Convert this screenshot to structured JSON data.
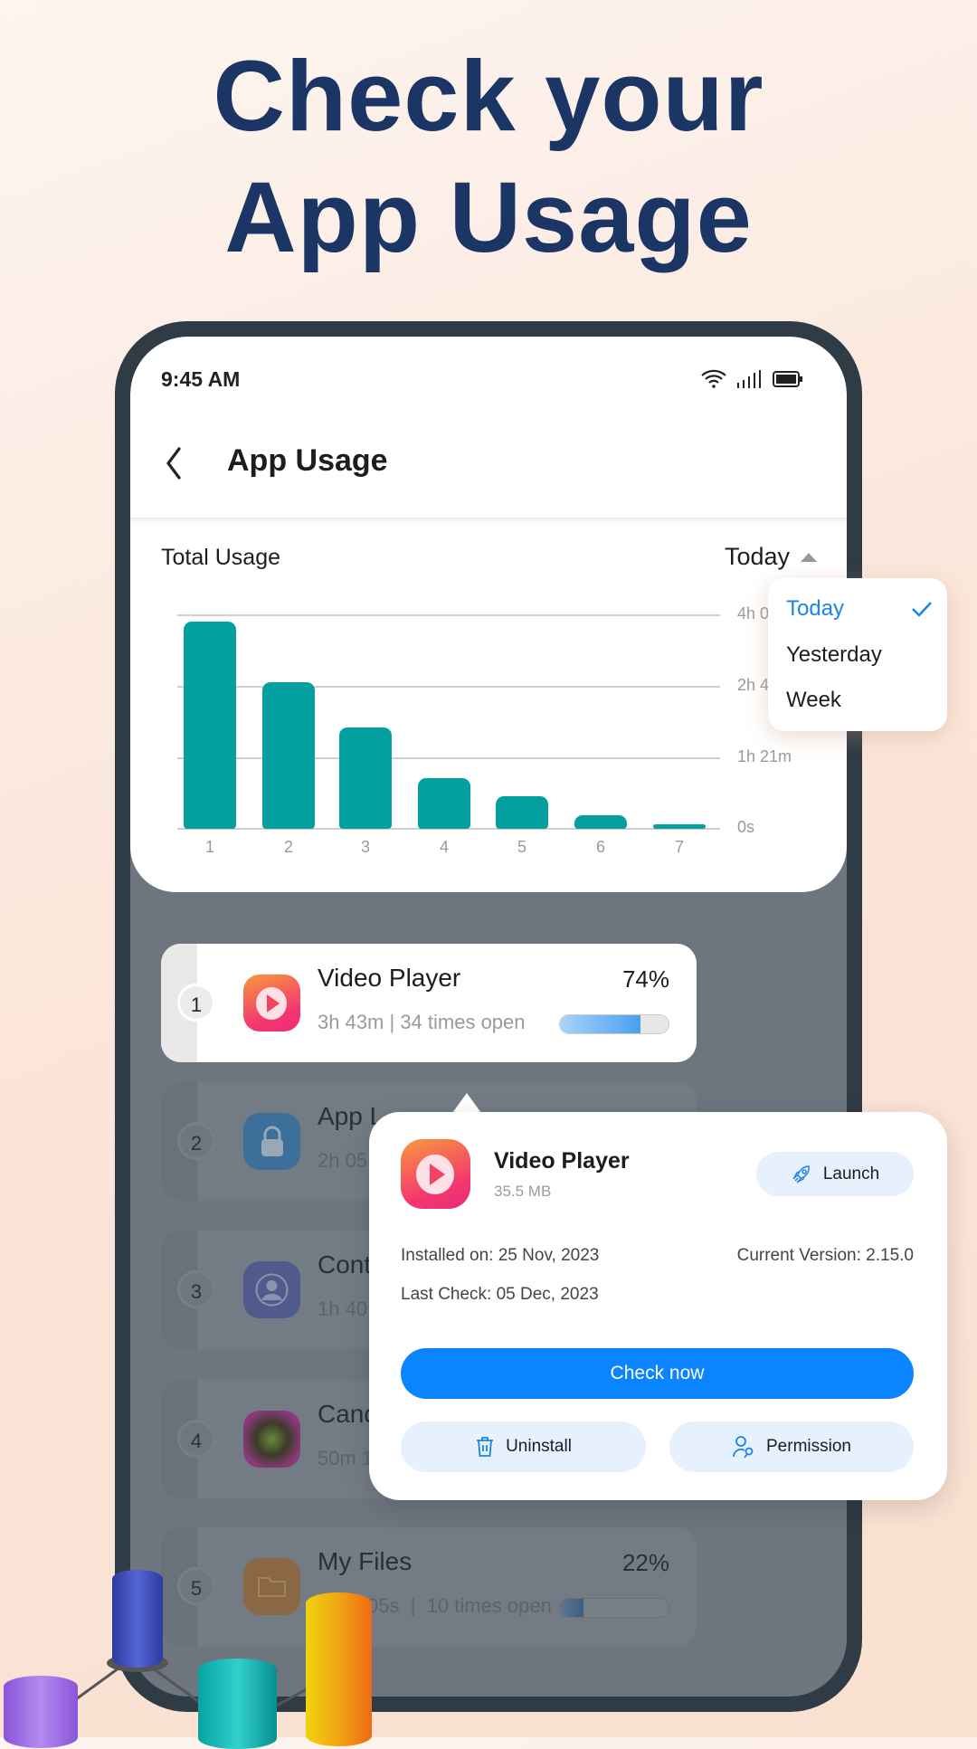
{
  "headline": {
    "line1": "Check your",
    "line2": "App Usage"
  },
  "status_bar": {
    "time": "9:45 AM",
    "icons": [
      "wifi-icon",
      "signal-icon",
      "battery-icon"
    ]
  },
  "header": {
    "title": "App Usage",
    "back_icon": "chevron-left-icon"
  },
  "usage": {
    "label": "Total Usage",
    "period": "Today"
  },
  "dropdown": {
    "options": [
      {
        "label": "Today",
        "selected": true
      },
      {
        "label": "Yesterday",
        "selected": false
      },
      {
        "label": "Week",
        "selected": false
      }
    ]
  },
  "chart_data": {
    "type": "bar",
    "categories": [
      "1",
      "2",
      "3",
      "4",
      "5",
      "6",
      "7"
    ],
    "values": [
      237,
      167,
      116,
      58,
      37,
      16,
      5
    ],
    "value_unit": "minutes",
    "ylim": [
      0,
      244
    ],
    "y_ticks": [
      {
        "value": 0,
        "label": "0s"
      },
      {
        "value": 81,
        "label": "1h 21m"
      },
      {
        "value": 162,
        "label": "2h 4"
      },
      {
        "value": 244,
        "label": "4h 0"
      }
    ],
    "grid": true,
    "color": "#04a09f"
  },
  "apps": [
    {
      "rank": "1",
      "name": "Video Player",
      "sub": "3h 43m  |  34 times open",
      "percent": "74%",
      "progress": 74,
      "icon": "video-player-icon"
    },
    {
      "rank": "2",
      "name": "App L",
      "sub": "2h 05",
      "icon": "lock-icon"
    },
    {
      "rank": "3",
      "name": "Cont",
      "sub": "1h 40",
      "icon": "contact-icon"
    },
    {
      "rank": "4",
      "name": "Cand",
      "sub": "50m 1",
      "icon": "candy-game-icon"
    },
    {
      "rank": "5",
      "name": "My Files",
      "sub": "05s  |  10 times open",
      "percent": "22%",
      "progress": 22,
      "icon": "folder-icon"
    }
  ],
  "popup": {
    "name": "Video Player",
    "size": "35.5 MB",
    "launch": "Launch",
    "installed": "Installed on: 25 Nov, 2023",
    "version": "Current Version: 2.15.0",
    "last_check": "Last Check: 05 Dec, 2023",
    "check_now": "Check now",
    "uninstall": "Uninstall",
    "permission": "Permission"
  },
  "colors": {
    "title": "#1b3565",
    "accent": "#0a84ff",
    "bar": "#04a09f",
    "selected": "#1a85e8"
  }
}
